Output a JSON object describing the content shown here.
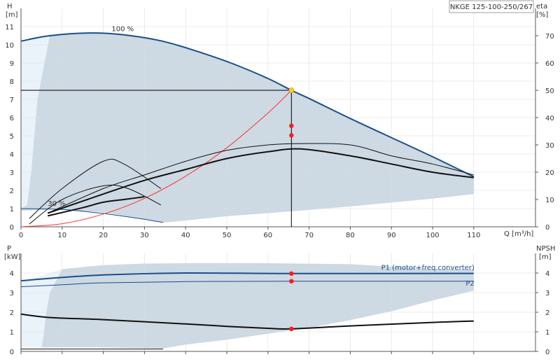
{
  "colors": {
    "region_fill": "#cdd9e3",
    "region_light": "#eaf2fa",
    "curve_blue": "#1c4e8a",
    "curve_black": "#111111",
    "system_red": "#ff3333",
    "grid": "#dddddd",
    "axis": "#555555",
    "marker_red": "#ff1a1a",
    "marker_yellow": "#ffcc33"
  },
  "chart_data": [
    {
      "type": "line",
      "title": "NKGE 125-100-250/267",
      "ylabel": "H",
      "yunit": "[m]",
      "y2label": "eta",
      "y2unit": "[%]",
      "xlabel": "Q [m³/h]",
      "xlim": [
        0,
        125
      ],
      "ylim": [
        0,
        12
      ],
      "y2lim": [
        0,
        80
      ],
      "x_ticks": [
        0,
        10,
        20,
        30,
        40,
        50,
        60,
        70,
        80,
        90,
        100,
        110
      ],
      "y_ticks": [
        0,
        1,
        2,
        3,
        4,
        5,
        6,
        7,
        8,
        9,
        10,
        11
      ],
      "y2_ticks": [
        0,
        10,
        20,
        30,
        40,
        50,
        60,
        70
      ],
      "grid": true,
      "labels": [
        {
          "text": "100 %",
          "x": 22,
          "y": 10.75
        },
        {
          "text": "30 %",
          "x": 6.5,
          "y": 1.15
        }
      ],
      "duty_point": {
        "x": 65.7,
        "y": 7.5
      },
      "eta_points": [
        {
          "x": 65.7,
          "eta": 37
        },
        {
          "x": 65.7,
          "eta": 33.5
        }
      ],
      "region": [
        [
          0,
          10.2
        ],
        [
          7,
          10.5
        ],
        [
          17,
          10.65
        ],
        [
          25,
          10.55
        ],
        [
          34,
          10.22
        ],
        [
          42,
          9.7
        ],
        [
          51,
          9.0
        ],
        [
          60,
          8.15
        ],
        [
          65.7,
          7.5
        ],
        [
          70,
          7.05
        ],
        [
          80,
          5.95
        ],
        [
          90,
          4.9
        ],
        [
          100,
          3.85
        ],
        [
          110,
          2.75
        ],
        [
          110,
          1.8
        ],
        [
          100,
          1.55
        ],
        [
          90,
          1.33
        ],
        [
          80,
          1.12
        ],
        [
          70,
          0.93
        ],
        [
          60,
          0.75
        ],
        [
          50,
          0.58
        ],
        [
          34.5,
          0.22
        ],
        [
          20,
          0.8
        ],
        [
          9,
          0.95
        ],
        [
          2,
          0.9
        ],
        [
          0,
          0.88
        ]
      ],
      "region_light": [
        [
          0,
          10.2
        ],
        [
          7,
          10.5
        ],
        [
          4,
          7
        ],
        [
          2.5,
          3
        ],
        [
          1.5,
          1.2
        ],
        [
          0,
          1.0
        ]
      ],
      "series": [
        {
          "key": "head_100",
          "axis": "y",
          "style": "blue_thick",
          "points": [
            [
              0,
              10.2
            ],
            [
              7,
              10.5
            ],
            [
              17,
              10.65
            ],
            [
              25,
              10.55
            ],
            [
              34,
              10.22
            ],
            [
              42,
              9.7
            ],
            [
              51,
              9.0
            ],
            [
              60,
              8.15
            ],
            [
              65.7,
              7.5
            ],
            [
              70,
              7.05
            ],
            [
              80,
              5.95
            ],
            [
              90,
              4.9
            ],
            [
              100,
              3.85
            ],
            [
              110,
              2.75
            ]
          ]
        },
        {
          "key": "head_30",
          "axis": "y",
          "style": "blue_thin",
          "points": [
            [
              0,
              1.0
            ],
            [
              10,
              0.95
            ],
            [
              20,
              0.73
            ],
            [
              28,
              0.48
            ],
            [
              34.5,
              0.24
            ]
          ]
        },
        {
          "key": "system",
          "axis": "y",
          "style": "red",
          "points": [
            [
              0,
              0
            ],
            [
              10,
              0.17
            ],
            [
              20,
              0.7
            ],
            [
              30,
              1.56
            ],
            [
              40,
              2.78
            ],
            [
              50,
              4.34
            ],
            [
              60,
              6.25
            ],
            [
              65.7,
              7.5
            ]
          ]
        },
        {
          "key": "eta_1",
          "axis": "y2",
          "style": "black_thin",
          "points": [
            [
              6.5,
              5
            ],
            [
              20,
              14
            ],
            [
              30,
              19
            ],
            [
              40,
              24
            ],
            [
              50,
              28
            ],
            [
              60,
              30
            ],
            [
              68,
              30.5
            ],
            [
              80,
              30
            ],
            [
              90,
              26
            ],
            [
              100,
              23
            ],
            [
              110,
              19
            ]
          ]
        },
        {
          "key": "eta_2",
          "axis": "y2",
          "style": "black_thick",
          "points": [
            [
              6.5,
              5
            ],
            [
              20,
              12
            ],
            [
              30,
              17
            ],
            [
              40,
              21
            ],
            [
              50,
              25
            ],
            [
              60,
              27.5
            ],
            [
              68,
              28.5
            ],
            [
              80,
              26
            ],
            [
              90,
              23
            ],
            [
              100,
              20
            ],
            [
              110,
              18
            ]
          ]
        },
        {
          "key": "eta_3",
          "axis": "y2",
          "style": "black_thin",
          "points": [
            [
              2,
              3
            ],
            [
              10,
              14
            ],
            [
              20,
              24
            ],
            [
              25,
              23
            ],
            [
              34,
              14
            ]
          ]
        },
        {
          "key": "eta_4",
          "axis": "y2",
          "style": "black_thin",
          "points": [
            [
              2,
              1
            ],
            [
              10,
              10
            ],
            [
              20,
              15
            ],
            [
              26,
              14
            ],
            [
              34,
              8
            ]
          ]
        },
        {
          "key": "eta_5",
          "axis": "y2",
          "style": "black_thick",
          "points": [
            [
              6.5,
              4
            ],
            [
              15,
              7
            ],
            [
              20,
              9
            ],
            [
              25,
              10
            ],
            [
              30,
              11
            ]
          ]
        }
      ]
    },
    {
      "type": "line",
      "ylabel": "P",
      "yunit": "[kW]",
      "y2label": "NPSH",
      "y2unit": "[m]",
      "xlim": [
        0,
        125
      ],
      "ylim": [
        0,
        5
      ],
      "y2lim": [
        0,
        5
      ],
      "y_ticks": [
        0,
        1,
        2,
        3,
        4
      ],
      "y2_ticks": [
        0,
        1,
        2,
        3,
        4
      ],
      "grid": true,
      "series_labels": [
        {
          "text": "P1 (motor+freq.converter)",
          "x": 110,
          "y": 4.3
        },
        {
          "text": "P2",
          "x": 110,
          "y": 3.5
        }
      ],
      "region": [
        [
          0,
          3.5
        ],
        [
          10,
          4.2
        ],
        [
          20,
          4.4
        ],
        [
          30,
          4.48
        ],
        [
          40,
          4.5
        ],
        [
          60,
          4.5
        ],
        [
          80,
          4.45
        ],
        [
          100,
          4.2
        ],
        [
          110,
          4.2
        ],
        [
          110,
          3.1
        ],
        [
          100,
          2.6
        ],
        [
          90,
          2.05
        ],
        [
          80,
          1.6
        ],
        [
          70,
          1.2
        ],
        [
          60,
          0.9
        ],
        [
          50,
          0.6
        ],
        [
          40,
          0.35
        ],
        [
          34.5,
          0.15
        ],
        [
          20,
          0.2
        ],
        [
          10,
          0.2
        ],
        [
          0,
          0.2
        ]
      ],
      "region_light": [
        [
          0,
          3.5
        ],
        [
          10,
          4.2
        ],
        [
          7,
          3
        ],
        [
          6,
          1.8
        ],
        [
          5.5,
          0.8
        ],
        [
          5,
          0.2
        ],
        [
          0,
          0.2
        ]
      ],
      "markers": [
        {
          "x": 65.7,
          "y": 3.97
        },
        {
          "x": 65.7,
          "y": 3.58
        },
        {
          "x": 65.7,
          "y": 1.15
        }
      ],
      "series": [
        {
          "key": "p1",
          "style": "blue_thick",
          "points": [
            [
              0,
              3.6
            ],
            [
              7,
              3.73
            ],
            [
              20,
              3.9
            ],
            [
              40,
              4.0
            ],
            [
              65.7,
              3.97
            ],
            [
              110,
              3.98
            ]
          ]
        },
        {
          "key": "p2",
          "style": "blue_thin",
          "points": [
            [
              0,
              3.3
            ],
            [
              10,
              3.4
            ],
            [
              20,
              3.5
            ],
            [
              40,
              3.56
            ],
            [
              65.7,
              3.58
            ],
            [
              110,
              3.58
            ]
          ]
        },
        {
          "key": "npsh",
          "style": "black_thick",
          "points": [
            [
              0,
              1.9
            ],
            [
              7,
              1.73
            ],
            [
              20,
              1.62
            ],
            [
              40,
              1.4
            ],
            [
              50,
              1.28
            ],
            [
              60,
              1.18
            ],
            [
              65.7,
              1.15
            ],
            [
              80,
              1.3
            ],
            [
              100,
              1.48
            ],
            [
              110,
              1.55
            ]
          ]
        },
        {
          "key": "p_30",
          "style": "black_thin",
          "points": [
            [
              0,
              0.12
            ],
            [
              34.5,
              0.12
            ]
          ]
        }
      ]
    }
  ]
}
